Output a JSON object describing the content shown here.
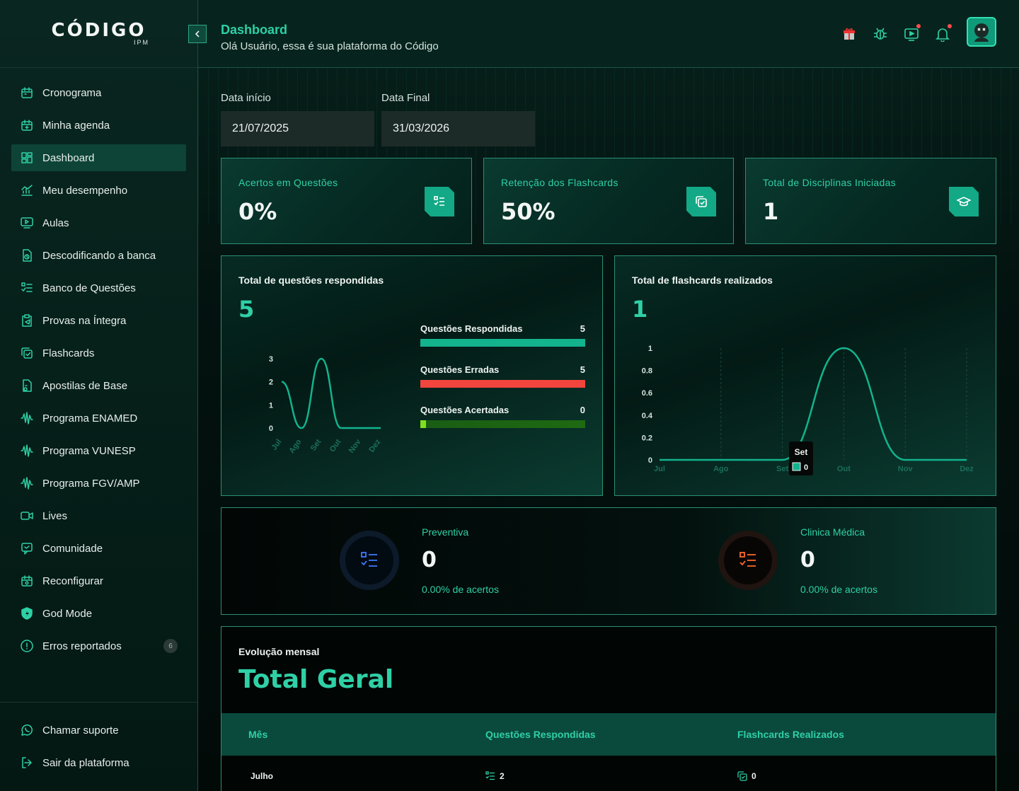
{
  "logo": {
    "main": "CÓDIGO",
    "sub": "IPM"
  },
  "sidebar": {
    "items": [
      {
        "label": "Cronograma",
        "icon": "calendar-icon"
      },
      {
        "label": "Minha agenda",
        "icon": "calendar-plus-icon"
      },
      {
        "label": "Dashboard",
        "icon": "dashboard-icon",
        "active": true
      },
      {
        "label": "Meu desempenho",
        "icon": "chart-icon"
      },
      {
        "label": "Aulas",
        "icon": "video-icon"
      },
      {
        "label": "Descodificando a banca",
        "icon": "file-code-icon"
      },
      {
        "label": "Banco de Questões",
        "icon": "list-check-icon"
      },
      {
        "label": "Provas na Íntegra",
        "icon": "clipboard-icon"
      },
      {
        "label": "Flashcards",
        "icon": "cards-icon"
      },
      {
        "label": "Apostilas de Base",
        "icon": "book-icon"
      },
      {
        "label": "Programa ENAMED",
        "icon": "wave-icon"
      },
      {
        "label": "Programa VUNESP",
        "icon": "wave-icon"
      },
      {
        "label": "Programa FGV/AMP",
        "icon": "wave-icon"
      },
      {
        "label": "Lives",
        "icon": "camera-icon"
      },
      {
        "label": "Comunidade",
        "icon": "message-icon"
      },
      {
        "label": "Reconfigurar",
        "icon": "calendar-gear-icon"
      },
      {
        "label": "God Mode",
        "icon": "shield-icon"
      },
      {
        "label": "Erros reportados",
        "icon": "alert-icon",
        "badge": "6"
      }
    ],
    "bottom": [
      {
        "label": "Chamar suporte",
        "icon": "whatsapp-icon"
      },
      {
        "label": "Sair da plataforma",
        "icon": "logout-icon"
      }
    ]
  },
  "header": {
    "title": "Dashboard",
    "subtitle": "Olá Usuário, essa é sua plataforma do Código"
  },
  "dates": {
    "start_label": "Data início",
    "start_value": "21/07/2025",
    "end_label": "Data Final",
    "end_value": "31/03/2026"
  },
  "stats": [
    {
      "label": "Acertos em Questões",
      "value": "0%",
      "icon": "list-check-icon"
    },
    {
      "label": "Retenção dos Flashcards",
      "value": "50%",
      "icon": "cards-icon"
    },
    {
      "label": "Total de Disciplinas Iniciadas",
      "value": "1",
      "icon": "graduation-cap-icon"
    }
  ],
  "questions_chart": {
    "title": "Total de questões respondidas",
    "total": "5",
    "bars": [
      {
        "label": "Questões Respondidas",
        "value": "5",
        "fill": 1.0,
        "color": "#13b38e"
      },
      {
        "label": "Questões Erradas",
        "value": "5",
        "fill": 1.0,
        "color": "#f2453d"
      },
      {
        "label": "Questões Acertadas",
        "value": "0",
        "fill": 0.0,
        "color": "#7ee01a"
      }
    ]
  },
  "flash_chart": {
    "title": "Total de flashcards realizados",
    "total": "1",
    "tooltip": {
      "label": "Set",
      "value": "0"
    }
  },
  "chart_data": [
    {
      "type": "line",
      "title": "Total de questões respondidas",
      "categories": [
        "Jul",
        "Ago",
        "Set",
        "Out",
        "Nov",
        "Dez"
      ],
      "values": [
        2,
        0,
        3,
        0,
        0,
        0
      ],
      "yticks": [
        "0",
        "1",
        "2",
        "3"
      ],
      "ylim": [
        0,
        3
      ]
    },
    {
      "type": "line",
      "title": "Total de flashcards realizados",
      "categories": [
        "Jul",
        "Ago",
        "Set",
        "Out",
        "Nov",
        "Dez"
      ],
      "values": [
        0,
        0,
        0,
        1,
        0,
        0
      ],
      "yticks": [
        "0",
        "0.2",
        "0.4",
        "0.6",
        "0.8",
        "1"
      ],
      "ylim": [
        0,
        1
      ]
    }
  ],
  "subjects": [
    {
      "name": "Preventiva",
      "value": "0",
      "pct": "0.00% de acertos",
      "color": "#3d7bff"
    },
    {
      "name": "Clinica Médica",
      "value": "0",
      "pct": "0.00% de acertos",
      "color": "#ff6a2b"
    }
  ],
  "evolution": {
    "small": "Evolução mensal",
    "title": "Total Geral",
    "headers": [
      "Mês",
      "Questões Respondidas",
      "Flashcards Realizados"
    ],
    "rows": [
      {
        "month": "Julho",
        "questions": "2",
        "flashcards": "0"
      }
    ]
  }
}
